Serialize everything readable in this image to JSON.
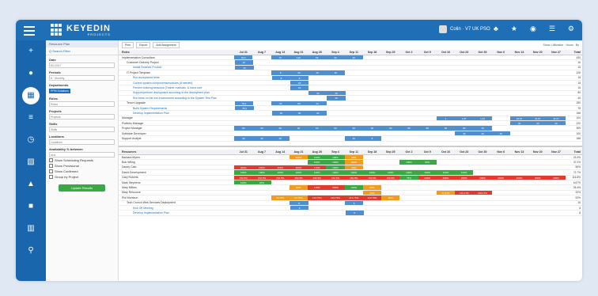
{
  "app": {
    "logo_text": "KEYEDIN",
    "logo_sub": "PROJECTS",
    "user": "Colin · V7 UK PSO"
  },
  "filters": {
    "header": "Resource Plan",
    "search": "Q Search Filter",
    "date_label": "Date",
    "date_value": "8/1/2017",
    "periods_label": "Periods",
    "periods_value": "8",
    "periods_unit": "Monthly",
    "departments_label": "Departments",
    "department_tag": "PPM Solutions",
    "roles_label": "Roles",
    "roles_ph": "Roles",
    "projects_label": "Projects",
    "projects_ph": "Projects",
    "skills_label": "Skills",
    "skills_ph": "Skills",
    "locations_label": "Locations",
    "locations_ph": "Locations",
    "avail_label": "Availability % between",
    "avail_value": "And",
    "cb1": "Show Scheduling Requests",
    "cb2": "Show Provisional",
    "cb3": "Show Confirmed",
    "cb4": "Group by Project",
    "update": "Update Results"
  },
  "toolbar": {
    "print": "Print",
    "export": "Export",
    "add": "Add Assignment",
    "right": "Show: Utilization · Hours · By"
  },
  "columns": [
    "Jul 31",
    "Aug 7",
    "Aug 14",
    "Aug 21",
    "Aug 28",
    "Sep 4",
    "Sep 11",
    "Sep 18",
    "Sep 25",
    "Oct 2",
    "Oct 9",
    "Oct 16",
    "Oct 23",
    "Oct 30",
    "Nov 6",
    "Nov 13",
    "Nov 20",
    "Nov 27"
  ],
  "total_label": "Total",
  "roles_header": "Roles",
  "resources_header": "Resources",
  "roles": [
    {
      "name": "Implementation Consultant",
      "lvl": "l1",
      "cells": {
        "0": "94.6",
        "2": "72",
        "3": "120",
        "4": "64",
        "5": "40",
        "6": "40"
      },
      "tot": "430"
    },
    {
      "name": "Customer Delivery Project",
      "lvl": "l2",
      "cells": {
        "0": "16"
      },
      "tot": "16"
    },
    {
      "name": "Install Finished Product",
      "lvl": "l3",
      "cells": {
        "0": "16"
      },
      "tot": "16"
    },
    {
      "name": "IT Project Template",
      "lvl": "l2",
      "cells": {
        "2": "8",
        "3": "40",
        "4": "40",
        "5": "40"
      },
      "tot": "126"
    },
    {
      "name": "Run acceptance tests",
      "lvl": "l3",
      "cells": {
        "2": "8",
        "3": "8"
      },
      "tot": "16"
    },
    {
      "name": "Correct system components/modules (if needed)",
      "lvl": "l3",
      "cells": {
        "3": "16"
      },
      "tot": "16"
    },
    {
      "name": "Perform training sessions (Trainer manuals, & hand over",
      "lvl": "l3",
      "cells": {
        "3": "16"
      },
      "tot": "16"
    },
    {
      "name": "Support/perform deployment according to the deployment plan",
      "lvl": "l3",
      "cells": {
        "4": "40",
        "5": "40"
      },
      "tot": "80"
    },
    {
      "name": "Run tests on the live environment according to the System Test Plan",
      "lvl": "l3",
      "cells": {
        "5": "40"
      },
      "tot": "40"
    },
    {
      "name": "Tenon Upgrade",
      "lvl": "l2",
      "cells": {
        "0": "78.4",
        "2": "64",
        "3": "80",
        "4": "24"
      },
      "tot": "250"
    },
    {
      "name": "Build System Requirements",
      "lvl": "l3",
      "cells": {
        "0": "78.4"
      },
      "tot": "78"
    },
    {
      "name": "Develop Implementation Plan",
      "lvl": "l3",
      "cells": {
        "2": "64",
        "3": "80",
        "4": "24"
      },
      "tot": "168"
    },
    {
      "name": "Manager",
      "lvl": "l1",
      "cells": {
        "11": "1",
        "12": "1.87",
        "13": "1.22",
        "15": "19.67",
        "16": "41.67",
        "17": "41.67"
      },
      "tot": "104"
    },
    {
      "name": "Portfolio Manager",
      "lvl": "l1",
      "cells": {
        "15": "40",
        "16": "40",
        "17": "40"
      },
      "tot": "120"
    },
    {
      "name": "Project Manager",
      "lvl": "l1",
      "cells": {
        "0": "60",
        "1": "60",
        "2": "60",
        "3": "30",
        "4": "60",
        "5": "60",
        "6": "60",
        "7": "60",
        "8": "60",
        "9": "80",
        "10": "80",
        "11": "80",
        "12": "80",
        "13": "76"
      },
      "tot": "909"
    },
    {
      "name": "Software Developer",
      "lvl": "l1",
      "cells": {
        "12": "40",
        "13": "40",
        "14": "20"
      },
      "tot": "100"
    },
    {
      "name": "Support Analyst",
      "lvl": "l1",
      "cells": {
        "0": "40",
        "1": "40",
        "2": "40",
        "6": "40",
        "7": "8"
      },
      "tot": "168"
    }
  ],
  "resources": [
    {
      "name": "Barbara Myers",
      "lvl": "l1",
      "cells": {
        "3": "o:100%",
        "4": "g:100%",
        "5": "g:100%",
        "6": "o:80%"
      },
      "tot": "23.3%"
    },
    {
      "name": "Bob Wiling",
      "lvl": "l1",
      "cells": {
        "4": "g:100%",
        "5": "g:100%",
        "6": "o:100%",
        "9": "g:100%",
        "10": "g:80%"
      },
      "tot": "37.2%"
    },
    {
      "name": "Danny Cato",
      "lvl": "l1",
      "cells": {
        "0": "r:200%",
        "1": "r:200%",
        "2": "r:200%",
        "3": "r:200%",
        "4": "r:140%",
        "5": "g:100%",
        "6": "o:40%"
      },
      "tot": "56%"
    },
    {
      "name": "David Development",
      "lvl": "l1",
      "cells": {
        "0": "g:100%",
        "1": "g:100%",
        "2": "g:100%",
        "3": "g:100%",
        "4": "g:100%",
        "5": "g:100%",
        "6": "g:100%",
        "7": "g:100%",
        "8": "g:100%",
        "9": "g:100%",
        "10": "g:100%",
        "11": "g:100%",
        "12": "g:100%"
      },
      "tot": "72.7%"
    },
    {
      "name": "Gary Roberts",
      "lvl": "l1",
      "cells": {
        "0": "r:152.5%",
        "1": "r:152.5%",
        "2": "r:152.5%",
        "3": "r:152.5%",
        "4": "r:152.5%",
        "5": "r:152.5%",
        "6": "r:152.5%",
        "7": "r:152.5%",
        "8": "r:152.5%",
        "9": "g:75%",
        "10": "r:200%",
        "11": "r:200%",
        "12": "r:200%",
        "13": "r:200%",
        "14": "r:200%",
        "15": "r:200%",
        "16": "r:200%",
        "17": "r:200%"
      },
      "tot": "116.8%"
    },
    {
      "name": "Mark Stephens",
      "lvl": "l1",
      "cells": {
        "0": "g:100%",
        "1": "g:20%"
      },
      "tot": "6.67%"
    },
    {
      "name": "Mary Millian",
      "lvl": "l1",
      "cells": {
        "3": "o:60%",
        "4": "r:140%",
        "5": "r:200%",
        "6": "g:100%",
        "7": "o:60%"
      },
      "tot": "26.4%"
    },
    {
      "name": "Mary Resource",
      "lvl": "l1",
      "cells": {
        "7": "o:40%",
        "11": "o:41.67%",
        "12": "r:133.17%",
        "13": "r:133.17%"
      },
      "tot": "20%"
    },
    {
      "name": "Phil Morrison",
      "lvl": "l1",
      "cells": {
        "2": "o:93.75%",
        "3": "o:93.75%",
        "4": "r:143.75%",
        "5": "r:143.75%",
        "6": "r:213.75%",
        "7": "r:213.75%",
        "8": "o:60%"
      },
      "tot": "53%"
    },
    {
      "name": "Tech Crunch Web Services Deployment",
      "lvl": "l2",
      "cells": {
        "3": "b:8",
        "6": "b:8"
      },
      "tot": "16"
    },
    {
      "name": "Kick Off Meeting",
      "lvl": "l3",
      "cells": {
        "3": "b:8"
      },
      "tot": "8"
    },
    {
      "name": "Develop Implementation Plan",
      "lvl": "l3",
      "cells": {
        "6": "b:8"
      },
      "tot": "8"
    }
  ],
  "colors": {
    "blue": "#1e6fb5",
    "green": "#39a845",
    "orange": "#f29b1d",
    "red": "#e23b2e",
    "cell_blue": "#4f8fd0"
  }
}
